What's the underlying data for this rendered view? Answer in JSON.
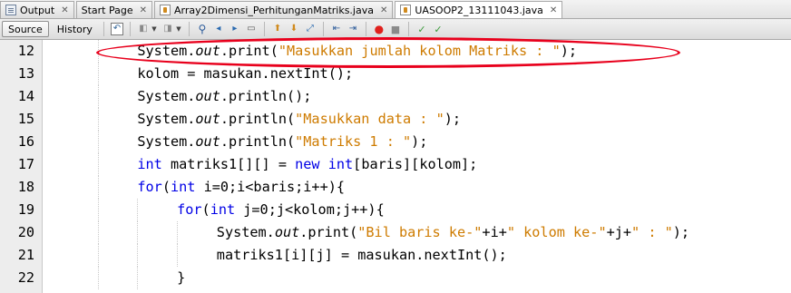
{
  "tabs": [
    {
      "label": "Output",
      "icon": "output-icon",
      "active": false
    },
    {
      "label": "Start Page",
      "icon": "",
      "active": false
    },
    {
      "label": "Array2Dimensi_PerhitunganMatriks.java",
      "icon": "java-file-icon",
      "active": false
    },
    {
      "label": "UASOOP2_13111043.java",
      "icon": "java-file-icon",
      "active": true
    }
  ],
  "toolbar": {
    "source_label": "Source",
    "history_label": "History"
  },
  "editor": {
    "lines": [
      {
        "number": "12",
        "indent": 2,
        "segments": [
          {
            "text": "System.",
            "kind": "plain"
          },
          {
            "text": "out",
            "kind": "italic"
          },
          {
            "text": ".print(",
            "kind": "plain"
          },
          {
            "text": "\"Masukkan jumlah kolom Matriks : \"",
            "kind": "string"
          },
          {
            "text": ");",
            "kind": "plain"
          }
        ]
      },
      {
        "number": "13",
        "indent": 2,
        "segments": [
          {
            "text": "kolom = masukan.nextInt();",
            "kind": "plain"
          }
        ]
      },
      {
        "number": "14",
        "indent": 2,
        "segments": [
          {
            "text": "System.",
            "kind": "plain"
          },
          {
            "text": "out",
            "kind": "italic"
          },
          {
            "text": ".println();",
            "kind": "plain"
          }
        ]
      },
      {
        "number": "15",
        "indent": 2,
        "segments": [
          {
            "text": "System.",
            "kind": "plain"
          },
          {
            "text": "out",
            "kind": "italic"
          },
          {
            "text": ".println(",
            "kind": "plain"
          },
          {
            "text": "\"Masukkan data : \"",
            "kind": "string"
          },
          {
            "text": ");",
            "kind": "plain"
          }
        ]
      },
      {
        "number": "16",
        "indent": 2,
        "segments": [
          {
            "text": "System.",
            "kind": "plain"
          },
          {
            "text": "out",
            "kind": "italic"
          },
          {
            "text": ".println(",
            "kind": "plain"
          },
          {
            "text": "\"Matriks 1 : \"",
            "kind": "string"
          },
          {
            "text": ");",
            "kind": "plain"
          }
        ]
      },
      {
        "number": "17",
        "indent": 2,
        "segments": [
          {
            "text": "int",
            "kind": "keyword"
          },
          {
            "text": " matriks1[][] = ",
            "kind": "plain"
          },
          {
            "text": "new",
            "kind": "keyword"
          },
          {
            "text": " ",
            "kind": "plain"
          },
          {
            "text": "int",
            "kind": "keyword"
          },
          {
            "text": "[baris][kolom];",
            "kind": "plain"
          }
        ]
      },
      {
        "number": "18",
        "indent": 2,
        "segments": [
          {
            "text": "for",
            "kind": "keyword"
          },
          {
            "text": "(",
            "kind": "plain"
          },
          {
            "text": "int",
            "kind": "keyword"
          },
          {
            "text": " i=0;i<baris;i++){",
            "kind": "plain"
          }
        ]
      },
      {
        "number": "19",
        "indent": 3,
        "segments": [
          {
            "text": "for",
            "kind": "keyword"
          },
          {
            "text": "(",
            "kind": "plain"
          },
          {
            "text": "int",
            "kind": "keyword"
          },
          {
            "text": " j=0;j<kolom;j++){",
            "kind": "plain"
          }
        ]
      },
      {
        "number": "20",
        "indent": 4,
        "segments": [
          {
            "text": "System.",
            "kind": "plain"
          },
          {
            "text": "out",
            "kind": "italic"
          },
          {
            "text": ".print(",
            "kind": "plain"
          },
          {
            "text": "\"Bil baris ke-\"",
            "kind": "string"
          },
          {
            "text": "+i+",
            "kind": "plain"
          },
          {
            "text": "\" kolom ke-\"",
            "kind": "string"
          },
          {
            "text": "+j+",
            "kind": "plain"
          },
          {
            "text": "\" : \"",
            "kind": "string"
          },
          {
            "text": ");",
            "kind": "plain"
          }
        ]
      },
      {
        "number": "21",
        "indent": 4,
        "segments": [
          {
            "text": "matriks1[i][j] = masukan.nextInt();",
            "kind": "plain"
          }
        ]
      },
      {
        "number": "22",
        "indent": 3,
        "segments": [
          {
            "text": "}",
            "kind": "plain"
          }
        ]
      }
    ]
  },
  "colors": {
    "keyword": "#0000e6",
    "string": "#ce7b00",
    "highlight_ellipse": "#e8001c",
    "gutter_background": "#ededed"
  }
}
